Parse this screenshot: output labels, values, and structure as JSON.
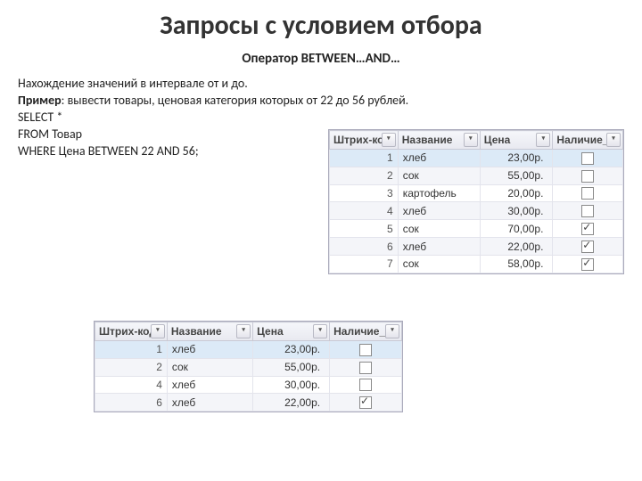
{
  "heading": "Запросы с условием отбора",
  "subtitle": "Оператор BETWEEN…AND…",
  "text1": "Нахождение значений в интервале от и до.",
  "example_label": "Пример",
  "example_text": ": вывести товары, ценовая категория которых от 22 до 56 рублей.",
  "sql1": "SELECT *",
  "sql2": "FROM Товар",
  "sql3": "WHERE Цена BETWEEN 22 AND 56;",
  "headers": {
    "code": "Штрих-код",
    "name": "Название",
    "price": "Цена",
    "stock": "Наличие_а"
  },
  "top_table": [
    {
      "id": "1",
      "name": "хлеб",
      "price": "23,00р.",
      "chk": false,
      "sel": true
    },
    {
      "id": "2",
      "name": "сок",
      "price": "55,00р.",
      "chk": false
    },
    {
      "id": "3",
      "name": "картофель",
      "price": "20,00р.",
      "chk": false
    },
    {
      "id": "4",
      "name": "хлеб",
      "price": "30,00р.",
      "chk": false
    },
    {
      "id": "5",
      "name": "сок",
      "price": "70,00р.",
      "chk": true
    },
    {
      "id": "6",
      "name": "хлеб",
      "price": "22,00р.",
      "chk": true
    },
    {
      "id": "7",
      "name": "сок",
      "price": "58,00р.",
      "chk": true
    }
  ],
  "bottom_table": [
    {
      "id": "1",
      "name": "хлеб",
      "price": "23,00р.",
      "chk": false,
      "sel": true
    },
    {
      "id": "2",
      "name": "сок",
      "price": "55,00р.",
      "chk": false
    },
    {
      "id": "4",
      "name": "хлеб",
      "price": "30,00р.",
      "chk": false
    },
    {
      "id": "6",
      "name": "хлеб",
      "price": "22,00р.",
      "chk": true
    }
  ]
}
